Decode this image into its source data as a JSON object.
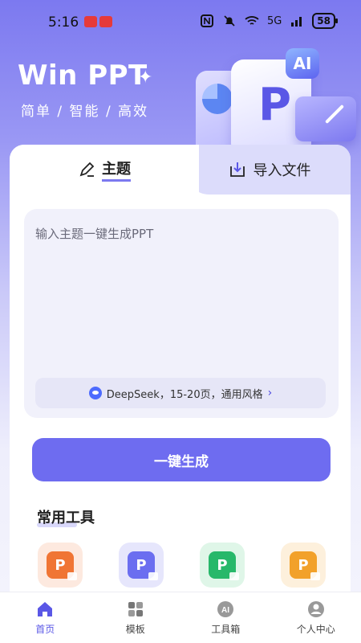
{
  "status_bar": {
    "time": "5:16",
    "network": "5G",
    "battery": "58"
  },
  "hero": {
    "title": "Win PPT",
    "subtitle": "简单 / 智能 / 高效",
    "ai_badge": "AI",
    "card_letter": "P"
  },
  "tabs": [
    {
      "label": "主题",
      "icon": "pencil-icon",
      "active": true
    },
    {
      "label": "导入文件",
      "icon": "import-file-icon",
      "active": false
    }
  ],
  "topic_input": {
    "placeholder": "输入主题一键生成PPT"
  },
  "generation_settings": {
    "label": "DeepSeek，15-20页，通用风格",
    "icon": "deepseek-icon"
  },
  "generate_button": {
    "label": "一键生成"
  },
  "tools_section": {
    "title": "常用工具",
    "tools": [
      {
        "icon": "ppt-doc-icon",
        "color": "#f07534",
        "letter": "P"
      },
      {
        "icon": "ppt-doc-icon",
        "color": "#6b6ef0",
        "letter": "P"
      },
      {
        "icon": "ppt-image-icon",
        "color": "#27b86a",
        "letter": "P"
      },
      {
        "icon": "ppt-magic-icon",
        "color": "#f2a12a",
        "letter": "P"
      }
    ]
  },
  "bottom_nav": [
    {
      "label": "首页",
      "icon": "home-icon",
      "active": true
    },
    {
      "label": "模板",
      "icon": "template-grid-icon",
      "active": false
    },
    {
      "label": "工具箱",
      "icon": "ai-toolbox-icon",
      "active": false
    },
    {
      "label": "个人中心",
      "icon": "profile-icon",
      "active": false
    }
  ],
  "colors": {
    "accent": "#6e6cf0",
    "hero_gradient_top": "#7c79f0"
  }
}
